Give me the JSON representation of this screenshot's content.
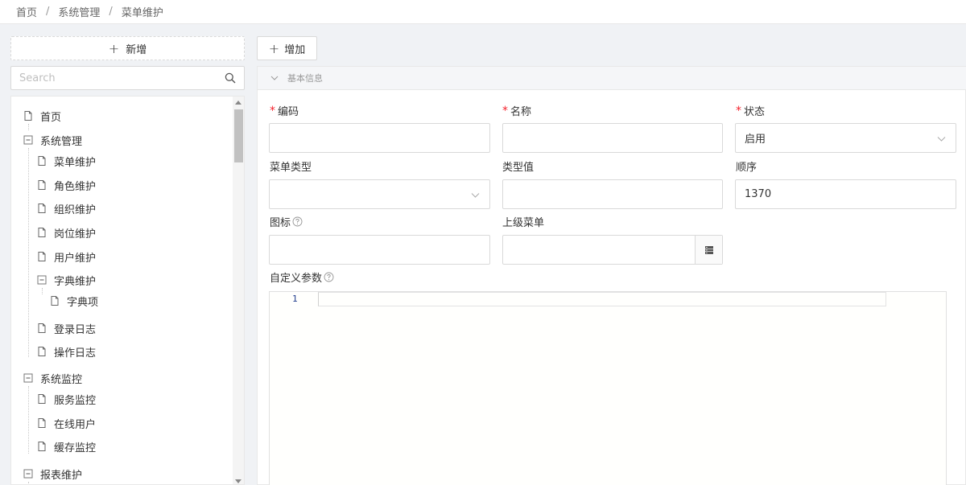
{
  "breadcrumb": {
    "items": [
      "首页",
      "系统管理",
      "菜单维护"
    ],
    "separator": "/"
  },
  "left": {
    "new_button": "新增",
    "search_placeholder": "Search",
    "tree": [
      {
        "label": "首页",
        "icon": "file-icon"
      },
      {
        "label": "系统管理",
        "icon": "minus-square-icon"
      },
      {
        "label": "菜单维护",
        "icon": "file-icon"
      },
      {
        "label": "角色维护",
        "icon": "file-icon"
      },
      {
        "label": "组织维护",
        "icon": "file-icon"
      },
      {
        "label": "岗位维护",
        "icon": "file-icon"
      },
      {
        "label": "用户维护",
        "icon": "file-icon"
      },
      {
        "label": "字典维护",
        "icon": "minus-square-icon"
      },
      {
        "label": "字典项",
        "icon": "file-icon"
      },
      {
        "label": "登录日志",
        "icon": "file-icon"
      },
      {
        "label": "操作日志",
        "icon": "file-icon"
      },
      {
        "label": "系统监控",
        "icon": "minus-square-icon"
      },
      {
        "label": "服务监控",
        "icon": "file-icon"
      },
      {
        "label": "在线用户",
        "icon": "file-icon"
      },
      {
        "label": "缓存监控",
        "icon": "file-icon"
      },
      {
        "label": "报表维护",
        "icon": "minus-square-icon"
      }
    ]
  },
  "right": {
    "add_button": "增加",
    "panel_title": "基本信息",
    "form": {
      "code_label": "编码",
      "code_value": "",
      "name_label": "名称",
      "name_value": "",
      "status_label": "状态",
      "status_value": "启用",
      "menu_type_label": "菜单类型",
      "menu_type_value": "",
      "type_value_label": "类型值",
      "type_value_value": "",
      "order_label": "顺序",
      "order_value": "1370",
      "icon_label": "图标",
      "icon_value": "",
      "parent_label": "上级菜单",
      "parent_value": "",
      "params_label": "自定义参数"
    },
    "editor": {
      "line_number": "1"
    }
  },
  "colors": {
    "required": "#f5222d",
    "border": "#d9d9d9",
    "background": "#f0f2f5"
  }
}
